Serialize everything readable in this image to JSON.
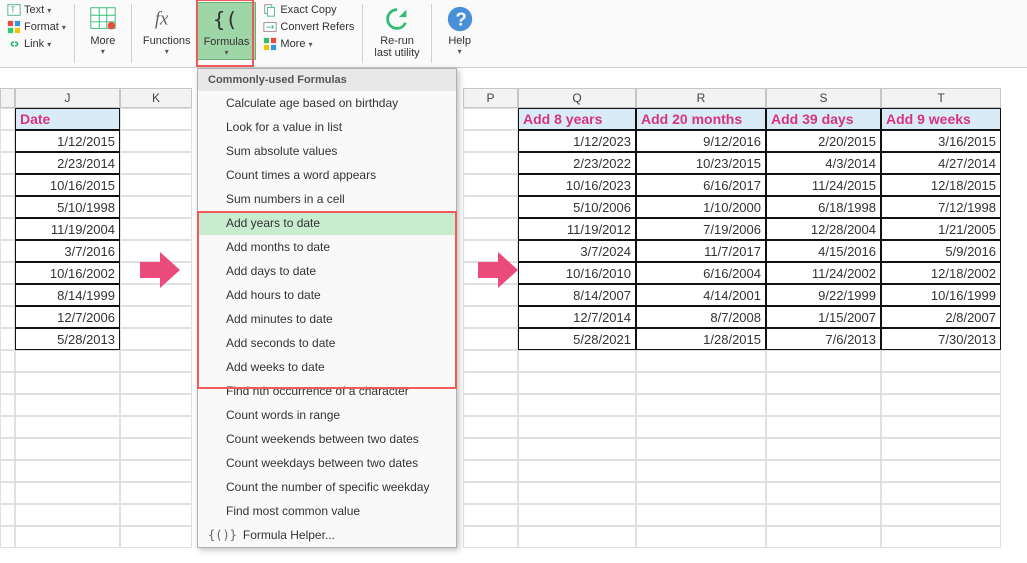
{
  "ribbon": {
    "text": "Text",
    "format": "Format",
    "link": "Link",
    "more1": "More",
    "functions": "Functions",
    "formulas": "Formulas",
    "exact_copy": "Exact Copy",
    "convert_refers": "Convert Refers",
    "more2": "More",
    "rerun": "Re-run\nlast utility",
    "help": "Help"
  },
  "menu": {
    "title": "Commonly-used Formulas",
    "items": [
      "Calculate age based on birthday",
      "Look for a value in list",
      "Sum absolute values",
      "Count times a word appears",
      "Sum numbers in a cell",
      "Add years to date",
      "Add months to date",
      "Add days to date",
      "Add hours to date",
      "Add minutes to date",
      "Add seconds to date",
      "Add weeks to date",
      "Find nth occurrence of a character",
      "Count words in range",
      "Count weekends between two dates",
      "Count weekdays between two dates",
      "Count the number of specific weekday",
      "Find most common value"
    ],
    "helper": "Formula Helper..."
  },
  "cols": {
    "J": "J",
    "K": "K",
    "P": "P",
    "Q": "Q",
    "R": "R",
    "S": "S",
    "T": "T"
  },
  "headers": {
    "date": "Date",
    "add_years": "Add 8 years",
    "add_months": "Add 20 months",
    "add_days": "Add 39 days",
    "add_weeks": "Add 9 weeks"
  },
  "data": {
    "J": [
      "1/12/2015",
      "2/23/2014",
      "10/16/2015",
      "5/10/1998",
      "11/19/2004",
      "3/7/2016",
      "10/16/2002",
      "8/14/1999",
      "12/7/2006",
      "5/28/2013"
    ],
    "Q": [
      "1/12/2023",
      "2/23/2022",
      "10/16/2023",
      "5/10/2006",
      "11/19/2012",
      "3/7/2024",
      "10/16/2010",
      "8/14/2007",
      "12/7/2014",
      "5/28/2021"
    ],
    "R": [
      "9/12/2016",
      "10/23/2015",
      "6/16/2017",
      "1/10/2000",
      "7/19/2006",
      "11/7/2017",
      "6/16/2004",
      "4/14/2001",
      "8/7/2008",
      "1/28/2015"
    ],
    "S": [
      "2/20/2015",
      "4/3/2014",
      "11/24/2015",
      "6/18/1998",
      "12/28/2004",
      "4/15/2016",
      "11/24/2002",
      "9/22/1999",
      "1/15/2007",
      "7/6/2013"
    ],
    "T": [
      "3/16/2015",
      "4/27/2014",
      "12/18/2015",
      "7/12/1998",
      "1/21/2005",
      "5/9/2016",
      "12/18/2002",
      "10/16/1999",
      "2/8/2007",
      "7/30/2013"
    ]
  }
}
